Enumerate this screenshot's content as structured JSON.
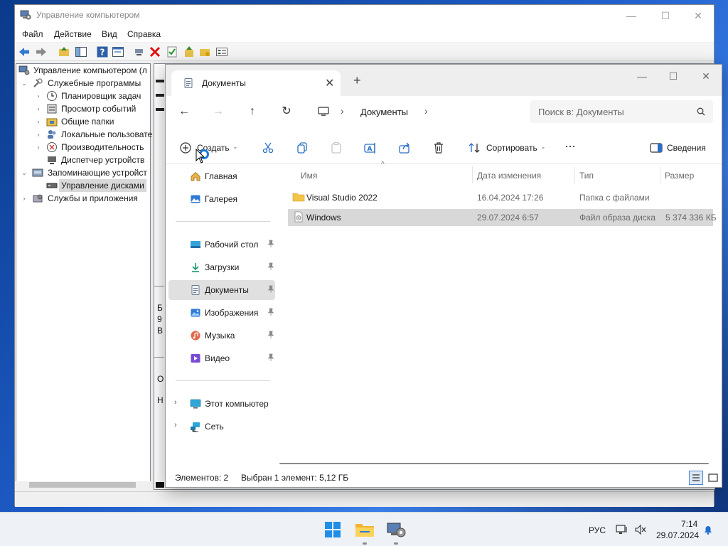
{
  "cm": {
    "title": "Управление компьютером",
    "menu": [
      "Файл",
      "Действие",
      "Вид",
      "Справка"
    ],
    "tree": [
      {
        "label": "Управление компьютером (л",
        "icon": "computer-management-icon"
      },
      {
        "label": "Служебные программы",
        "icon": "tools-icon"
      },
      {
        "label": "Планировщик задач",
        "icon": "clock-icon"
      },
      {
        "label": "Просмотр событий",
        "icon": "event-viewer-icon"
      },
      {
        "label": "Общие папки",
        "icon": "shared-folder-icon"
      },
      {
        "label": "Локальные пользовате",
        "icon": "users-icon"
      },
      {
        "label": "Производительность",
        "icon": "performance-icon"
      },
      {
        "label": "Диспетчер устройств",
        "icon": "device-manager-icon"
      },
      {
        "label": "Запоминающие устройст",
        "icon": "storage-icon"
      },
      {
        "label": "Управление дисками",
        "icon": "disk-management-icon"
      },
      {
        "label": "Службы и приложения",
        "icon": "services-icon"
      }
    ],
    "right_fragments": [
      "Б",
      "9",
      "В",
      "О",
      "Н"
    ]
  },
  "explorer": {
    "tab_title": "Документы",
    "nav": {
      "back": "←",
      "forward": "→",
      "up": "↑",
      "refresh": "↻"
    },
    "breadcrumb": [
      "Документы"
    ],
    "search_placeholder": "Поиск в: Документы",
    "commands": {
      "new": "Создать",
      "sort": "Сортировать",
      "details": "Сведения",
      "more": "···"
    },
    "sidebar": [
      {
        "label": "Главная",
        "icon": "home-icon"
      },
      {
        "label": "Галерея",
        "icon": "gallery-icon"
      },
      {
        "label": "Рабочий стол",
        "icon": "desktop-icon",
        "pinned": true
      },
      {
        "label": "Загрузки",
        "icon": "downloads-icon",
        "pinned": true
      },
      {
        "label": "Документы",
        "icon": "documents-icon",
        "pinned": true,
        "selected": true
      },
      {
        "label": "Изображения",
        "icon": "pictures-icon",
        "pinned": true
      },
      {
        "label": "Музыка",
        "icon": "music-icon",
        "pinned": true
      },
      {
        "label": "Видео",
        "icon": "videos-icon",
        "pinned": true
      },
      {
        "label": "Этот компьютер",
        "icon": "this-pc-icon"
      },
      {
        "label": "Сеть",
        "icon": "network-icon"
      }
    ],
    "columns": [
      "Имя",
      "Дата изменения",
      "Тип",
      "Размер"
    ],
    "files": [
      {
        "name": "Visual Studio 2022",
        "date": "16.04.2024 17:26",
        "type": "Папка с файлами",
        "size": "",
        "icon": "folder-icon"
      },
      {
        "name": "Windows",
        "date": "29.07.2024 6:57",
        "type": "Файл образа диска",
        "size": "5 374 336 КБ",
        "icon": "disc-image-icon",
        "selected": true
      }
    ],
    "status": {
      "count": "Элементов: 2",
      "selection": "Выбран 1 элемент: 5,12 ГБ"
    }
  },
  "taskbar": {
    "language": "РУС",
    "time": "7:14",
    "date": "29.07.2024"
  }
}
